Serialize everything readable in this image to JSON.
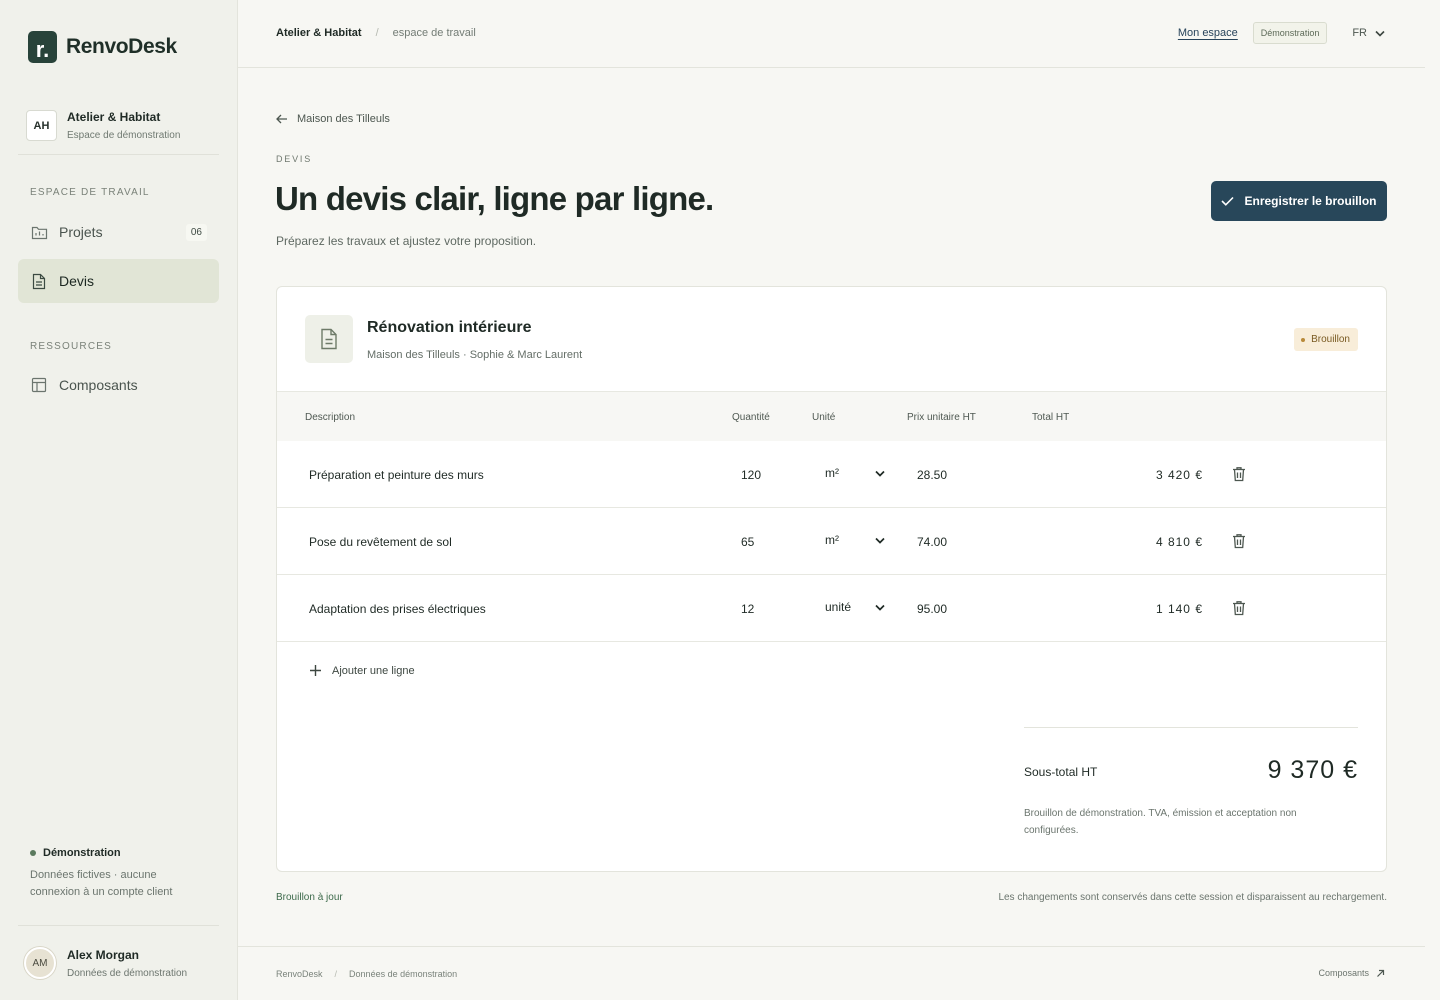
{
  "app": {
    "logo_letter": "r.",
    "name": "RenvoDesk"
  },
  "workspace": {
    "initials": "AH",
    "name": "Atelier & Habitat",
    "subtitle": "Espace de démonstration"
  },
  "sidebar": {
    "section_workspace": "ESPACE DE TRAVAIL",
    "items": [
      {
        "label": "Projets",
        "badge": "06",
        "icon": "folder-icon",
        "active": false
      },
      {
        "label": "Devis",
        "icon": "document-icon",
        "active": true
      }
    ],
    "section_resources": "RESSOURCES",
    "resources": [
      {
        "label": "Composants",
        "icon": "layout-icon"
      }
    ],
    "demo": {
      "title": "Démonstration",
      "text": "Données fictives · aucune connexion à un compte client"
    },
    "user": {
      "initials": "AM",
      "name": "Alex Morgan",
      "subtitle": "Données de démonstration"
    }
  },
  "header": {
    "breadcrumb_1": "Atelier & Habitat",
    "breadcrumb_sep": "/",
    "breadcrumb_2": "espace de travail",
    "link": "Mon espace",
    "badge": "Démonstration",
    "lang": "FR"
  },
  "main": {
    "back_label": "Maison des Tilleuls",
    "eyebrow": "DEVIS",
    "title": "Un devis clair, ligne par ligne.",
    "subtitle": "Préparez les travaux et ajustez votre proposition.",
    "save_label": "Enregistrer le brouillon"
  },
  "quote": {
    "title": "Rénovation intérieure",
    "subtitle": "Maison des Tilleuls · Sophie & Marc Laurent",
    "status": "Brouillon",
    "columns": [
      "Description",
      "Quantité",
      "Unité",
      "Prix unitaire HT",
      "Total HT"
    ],
    "rows": [
      {
        "description": "Préparation et peinture des murs",
        "quantity": "120",
        "unit": "m²",
        "unit_price": "28.50",
        "total": "3 420 €"
      },
      {
        "description": "Pose du revêtement de sol",
        "quantity": "65",
        "unit": "m²",
        "unit_price": "74.00",
        "total": "4 810 €"
      },
      {
        "description": "Adaptation des prises électriques",
        "quantity": "12",
        "unit": "unité",
        "unit_price": "95.00",
        "total": "1 140 €"
      }
    ],
    "add_line": "Ajouter une ligne",
    "subtotal_label": "Sous-total HT",
    "subtotal_value": "9 370 €",
    "note": "Brouillon de démonstration. TVA, émission et acceptation non configurées."
  },
  "status_bar": {
    "draft": "Brouillon à jour",
    "session_note": "Les changements sont conservés dans cette session et disparaissent au rechargement."
  },
  "footer": {
    "brand": "RenvoDesk",
    "sep": "/",
    "data": "Données de démonstration",
    "link": "Composants"
  },
  "colors": {
    "primary": "#28475a",
    "brand": "#28433a",
    "active_nav": "#e1e5d6",
    "status_bg": "#f8edd9"
  }
}
